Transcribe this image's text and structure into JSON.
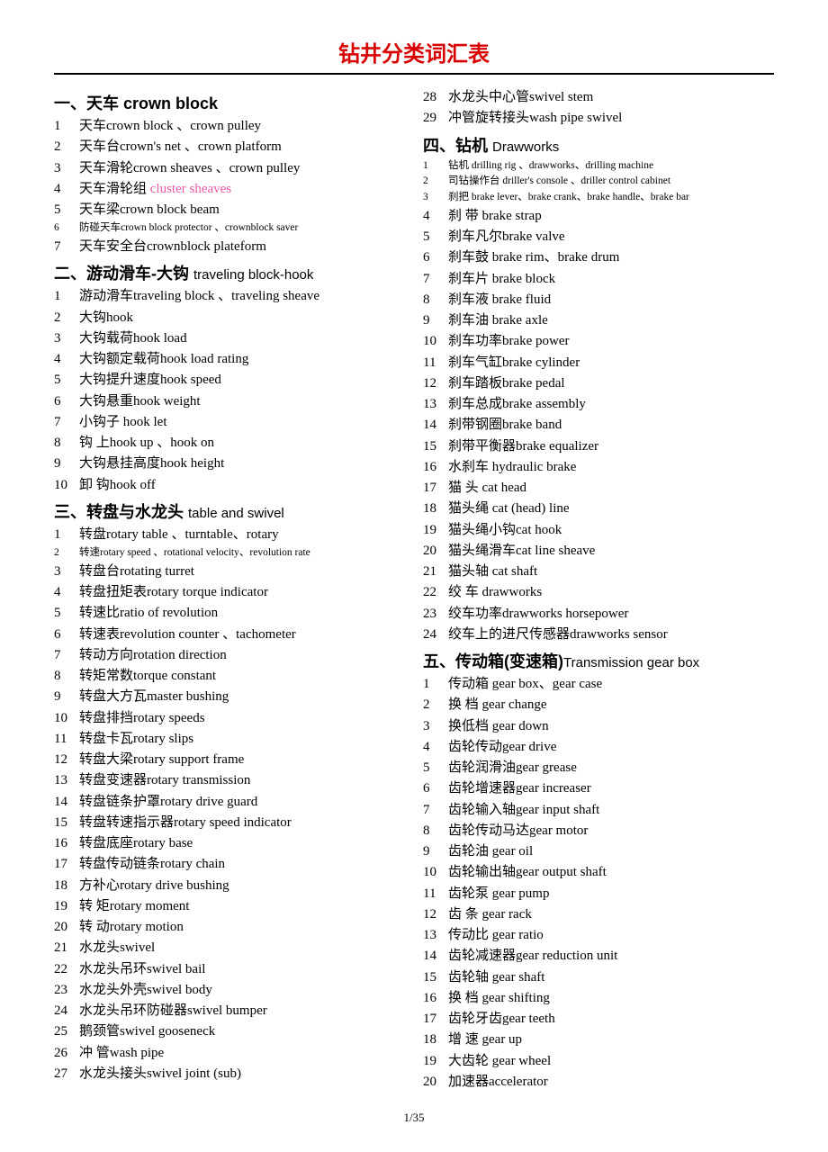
{
  "title": "钻井分类词汇表",
  "footer": "1/35",
  "columns": [
    [
      {
        "type": "header",
        "text": "一、天车  crown block"
      },
      {
        "type": "item",
        "num": "1",
        "text": "天车crown block 、crown pulley"
      },
      {
        "type": "item",
        "num": "2",
        "text": "天车台crown's net 、crown platform"
      },
      {
        "type": "item",
        "num": "3",
        "text": "天车滑轮crown sheaves 、crown pulley"
      },
      {
        "type": "item",
        "num": "4",
        "text": "天车滑轮组  ",
        "pink": "cluster sheaves"
      },
      {
        "type": "item",
        "num": "5",
        "text": "天车梁crown block beam"
      },
      {
        "type": "item",
        "num": "6",
        "text": "防碰天车crown block protector 、crownblock saver",
        "small": true
      },
      {
        "type": "item",
        "num": "7",
        "text": "天车安全台crownblock plateform"
      },
      {
        "type": "header",
        "text": "二、游动滑车-大钩 ",
        "sub": "traveling block-hook"
      },
      {
        "type": "item",
        "num": "1",
        "text": "游动滑车traveling block 、traveling sheave"
      },
      {
        "type": "item",
        "num": "2",
        "text": "大钩hook"
      },
      {
        "type": "item",
        "num": "3",
        "text": "大钩载荷hook load"
      },
      {
        "type": "item",
        "num": "4",
        "text": "大钩额定载荷hook load rating"
      },
      {
        "type": "item",
        "num": "5",
        "text": "大钩提升速度hook speed"
      },
      {
        "type": "item",
        "num": "6",
        "text": "大钩悬重hook weight"
      },
      {
        "type": "item",
        "num": "7",
        "text": "小钩子  hook let"
      },
      {
        "type": "item",
        "num": "8",
        "text": "钩    上hook up 、hook on"
      },
      {
        "type": "item",
        "num": "9",
        "text": "大钩悬挂高度hook height"
      },
      {
        "type": "item",
        "num": "10",
        "text": "卸    钩hook off"
      },
      {
        "type": "header",
        "text": "三、转盘与水龙头 ",
        "sub": "table and swivel"
      },
      {
        "type": "item",
        "num": "1",
        "text": "转盘rotary table 、turntable、rotary"
      },
      {
        "type": "item",
        "num": "2",
        "text": "转速rotary speed 、rotational velocity、revolution rate",
        "small": true
      },
      {
        "type": "item",
        "num": "3",
        "text": "转盘台rotating turret"
      },
      {
        "type": "item",
        "num": "4",
        "text": "转盘扭矩表rotary torque indicator"
      },
      {
        "type": "item",
        "num": "5",
        "text": "转速比ratio of revolution"
      },
      {
        "type": "item",
        "num": "6",
        "text": "转速表revolution counter 、tachometer"
      },
      {
        "type": "item",
        "num": "7",
        "text": "转动方向rotation direction"
      },
      {
        "type": "item",
        "num": "8",
        "text": "转矩常数torque constant"
      },
      {
        "type": "item",
        "num": "9",
        "text": "转盘大方瓦master bushing"
      },
      {
        "type": "item",
        "num": "10",
        "text": "转盘排挡rotary speeds"
      },
      {
        "type": "item",
        "num": "11",
        "text": "转盘卡瓦rotary slips"
      },
      {
        "type": "item",
        "num": "12",
        "text": "转盘大梁rotary support frame"
      },
      {
        "type": "item",
        "num": "13",
        "text": "转盘变速器rotary transmission"
      },
      {
        "type": "item",
        "num": "14",
        "text": "转盘链条护罩rotary drive guard"
      },
      {
        "type": "item",
        "num": "15",
        "text": "转盘转速指示器rotary speed indicator"
      },
      {
        "type": "item",
        "num": "16",
        "text": "转盘底座rotary base"
      },
      {
        "type": "item",
        "num": "17",
        "text": "转盘传动链条rotary chain"
      },
      {
        "type": "item",
        "num": "18",
        "text": "方补心rotary drive bushing"
      },
      {
        "type": "item",
        "num": "19",
        "text": "转  矩rotary moment"
      },
      {
        "type": "item",
        "num": "20",
        "text": "转  动rotary motion"
      },
      {
        "type": "item",
        "num": "21",
        "text": "水龙头swivel"
      },
      {
        "type": "item",
        "num": "22",
        "text": "水龙头吊环swivel bail"
      },
      {
        "type": "item",
        "num": "23",
        "text": "水龙头外壳swivel body"
      },
      {
        "type": "item",
        "num": "24",
        "text": "水龙头吊环防碰器swivel bumper"
      },
      {
        "type": "item",
        "num": "25",
        "text": "鹅颈管swivel gooseneck"
      },
      {
        "type": "item",
        "num": "26",
        "text": "冲  管wash pipe"
      },
      {
        "type": "item",
        "num": "27",
        "text": "水龙头接头swivel joint (sub)"
      }
    ],
    [
      {
        "type": "item",
        "num": "28",
        "text": "水龙头中心管swivel stem"
      },
      {
        "type": "item",
        "num": "29",
        "text": "冲管旋转接头wash pipe swivel"
      },
      {
        "type": "header",
        "text": "四、钻机 ",
        "sub": "Drawworks"
      },
      {
        "type": "item",
        "num": "1",
        "text": "钻机 drilling rig 、drawworks、drilling machine",
        "small": true
      },
      {
        "type": "item",
        "num": "2",
        "text": "司钻操作台 driller's console 、driller control cabinet",
        "small": true
      },
      {
        "type": "item",
        "num": "3",
        "text": "刹把 brake lever、brake crank、brake handle、brake bar",
        "small": true
      },
      {
        "type": "item",
        "num": "4",
        "text": "刹  带  brake strap"
      },
      {
        "type": "item",
        "num": "5",
        "text": "刹车凡尔brake valve"
      },
      {
        "type": "item",
        "num": "6",
        "text": "刹车鼓  brake rim、brake drum"
      },
      {
        "type": "item",
        "num": "7",
        "text": "刹车片  brake block"
      },
      {
        "type": "item",
        "num": "8",
        "text": "刹车液  brake fluid"
      },
      {
        "type": "item",
        "num": "9",
        "text": "刹车油  brake axle"
      },
      {
        "type": "item",
        "num": "10",
        "text": "刹车功率brake power"
      },
      {
        "type": "item",
        "num": "11",
        "text": "刹车气缸brake cylinder"
      },
      {
        "type": "item",
        "num": "12",
        "text": "刹车踏板brake pedal"
      },
      {
        "type": "item",
        "num": "13",
        "text": "刹车总成brake assembly"
      },
      {
        "type": "item",
        "num": "14",
        "text": "刹带钢圈brake band"
      },
      {
        "type": "item",
        "num": "15",
        "text": "刹带平衡器brake equalizer"
      },
      {
        "type": "item",
        "num": "16",
        "text": "水刹车  hydraulic brake"
      },
      {
        "type": "item",
        "num": "17",
        "text": "猫  头  cat head"
      },
      {
        "type": "item",
        "num": "18",
        "text": "猫头绳  cat (head) line"
      },
      {
        "type": "item",
        "num": "19",
        "text": "猫头绳小钩cat hook"
      },
      {
        "type": "item",
        "num": "20",
        "text": "猫头绳滑车cat line sheave"
      },
      {
        "type": "item",
        "num": "21",
        "text": "猫头轴  cat shaft"
      },
      {
        "type": "item",
        "num": "22",
        "text": "绞  车  drawworks"
      },
      {
        "type": "item",
        "num": "23",
        "text": "绞车功率drawworks horsepower"
      },
      {
        "type": "item",
        "num": "24",
        "text": "绞车上的进尺传感器drawworks sensor"
      },
      {
        "type": "header",
        "text": "五、传动箱(变速箱)",
        "sub": "Transmission gear box"
      },
      {
        "type": "item",
        "num": "1",
        "text": "传动箱  gear box、gear case"
      },
      {
        "type": "item",
        "num": "2",
        "text": "换  档  gear change"
      },
      {
        "type": "item",
        "num": "3",
        "text": "换低档  gear down"
      },
      {
        "type": "item",
        "num": "4",
        "text": "齿轮传动gear drive"
      },
      {
        "type": "item",
        "num": "5",
        "text": "齿轮润滑油gear grease"
      },
      {
        "type": "item",
        "num": "6",
        "text": "齿轮增速器gear increaser"
      },
      {
        "type": "item",
        "num": "7",
        "text": "齿轮输入轴gear input shaft"
      },
      {
        "type": "item",
        "num": "8",
        "text": "齿轮传动马达gear motor"
      },
      {
        "type": "item",
        "num": "9",
        "text": "齿轮油  gear oil"
      },
      {
        "type": "item",
        "num": "10",
        "text": "齿轮输出轴gear output shaft"
      },
      {
        "type": "item",
        "num": "11",
        "text": "齿轮泵  gear pump"
      },
      {
        "type": "item",
        "num": "12",
        "text": "齿  条  gear rack"
      },
      {
        "type": "item",
        "num": "13",
        "text": "传动比  gear ratio"
      },
      {
        "type": "item",
        "num": "14",
        "text": "齿轮减速器gear reduction unit"
      },
      {
        "type": "item",
        "num": "15",
        "text": "齿轮轴  gear shaft"
      },
      {
        "type": "item",
        "num": "16",
        "text": "换  档  gear shifting"
      },
      {
        "type": "item",
        "num": "17",
        "text": "齿轮牙齿gear teeth"
      },
      {
        "type": "item",
        "num": "18",
        "text": "增  速  gear up"
      },
      {
        "type": "item",
        "num": "19",
        "text": "大齿轮  gear wheel"
      },
      {
        "type": "item",
        "num": "20",
        "text": "加速器accelerator"
      }
    ]
  ]
}
